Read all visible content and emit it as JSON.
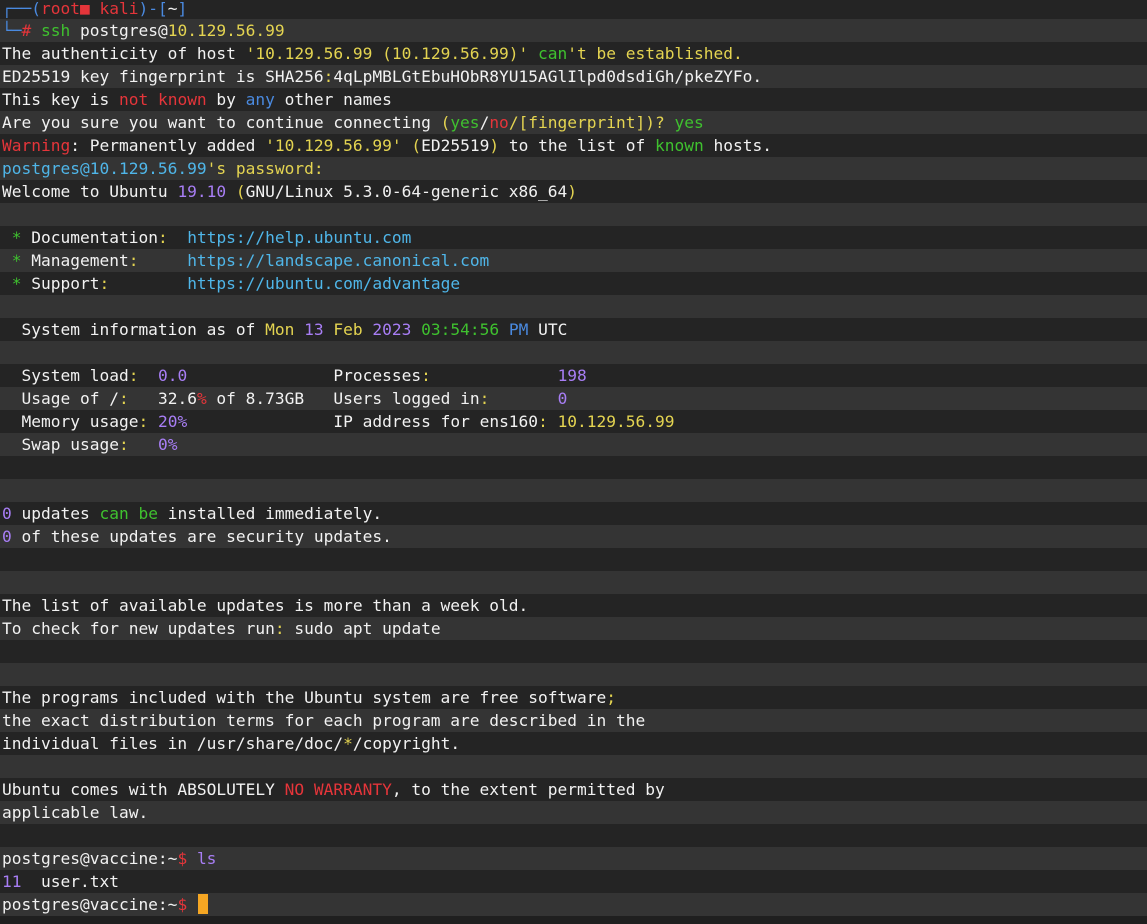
{
  "window": {
    "title": ""
  },
  "colors": {
    "default": "#f2f2f2",
    "blue": "#4a8ae0",
    "red": "#e5353a",
    "green": "#3fc12f",
    "yellow": "#e4d451",
    "purple": "#a87ef5",
    "cyan": "#4fb6e9",
    "cursor": "#f5a623"
  },
  "terminal": {
    "lines": [
      [
        [
          "┌──(",
          "blue"
        ],
        [
          "root",
          "red"
        ],
        [
          "■ ",
          "red"
        ],
        [
          "kali",
          "red"
        ],
        [
          ")-[",
          "blue"
        ],
        [
          "~",
          "default"
        ],
        [
          "]",
          "blue"
        ]
      ],
      [
        [
          "└─",
          "blue"
        ],
        [
          "# ",
          "red"
        ],
        [
          "ssh ",
          "green"
        ],
        [
          "postgres@",
          "default"
        ],
        [
          "10.129.56.99",
          "yellow"
        ]
      ],
      [
        [
          "The authenticity of host ",
          "default"
        ],
        [
          "'10.129.56.99 (10.129.56.99)'",
          "yellow"
        ],
        [
          " ",
          "default"
        ],
        [
          "can",
          "green"
        ],
        [
          "'t be established.",
          "yellow"
        ]
      ],
      [
        [
          "ED25519 key fingerprint is SHA256",
          "default"
        ],
        [
          ":",
          "yellow"
        ],
        [
          "4qLpMBLGtEbuHObR8YU15AGlIlpd0dsdiGh/pkeZYFo.",
          "default"
        ]
      ],
      [
        [
          "This key is ",
          "default"
        ],
        [
          "not",
          "red"
        ],
        [
          " ",
          "default"
        ],
        [
          "known",
          "red"
        ],
        [
          " by ",
          "default"
        ],
        [
          "any",
          "blue"
        ],
        [
          " other names",
          "default"
        ]
      ],
      [
        [
          "Are you sure you want to continue connecting ",
          "default"
        ],
        [
          "(",
          "yellow"
        ],
        [
          "yes",
          "green"
        ],
        [
          "/",
          "default"
        ],
        [
          "no",
          "red"
        ],
        [
          "/[fingerprint])? ",
          "yellow"
        ],
        [
          "yes",
          "green"
        ]
      ],
      [
        [
          "Warning",
          "red"
        ],
        [
          ": Permanently added ",
          "default"
        ],
        [
          "'10.129.56.99'",
          "yellow"
        ],
        [
          " ",
          "default"
        ],
        [
          "(",
          "yellow"
        ],
        [
          "ED25519",
          "default"
        ],
        [
          ")",
          "yellow"
        ],
        [
          " to the list of ",
          "default"
        ],
        [
          "known",
          "green"
        ],
        [
          " hosts.",
          "default"
        ]
      ],
      [
        [
          "postgres@10.129.56.99",
          "cyan"
        ],
        [
          "'s password:",
          "yellow"
        ]
      ],
      [
        [
          "Welcome to Ubuntu ",
          "default"
        ],
        [
          "19.10",
          "purple"
        ],
        [
          " ",
          "default"
        ],
        [
          "(",
          "yellow"
        ],
        [
          "GNU/Linux 5.3.0-64-generic x86_64",
          "default"
        ],
        [
          ")",
          "yellow"
        ]
      ],
      [],
      [
        [
          " ",
          "default"
        ],
        [
          "*",
          "green"
        ],
        [
          " Documentation",
          "default"
        ],
        [
          ":",
          "yellow"
        ],
        [
          "  ",
          "default"
        ],
        [
          "https://help.ubuntu.com",
          "cyan"
        ]
      ],
      [
        [
          " ",
          "default"
        ],
        [
          "*",
          "green"
        ],
        [
          " Management",
          "default"
        ],
        [
          ":",
          "yellow"
        ],
        [
          "     ",
          "default"
        ],
        [
          "https://landscape.canonical.com",
          "cyan"
        ]
      ],
      [
        [
          " ",
          "default"
        ],
        [
          "*",
          "green"
        ],
        [
          " Support",
          "default"
        ],
        [
          ":",
          "yellow"
        ],
        [
          "        ",
          "default"
        ],
        [
          "https://ubuntu.com/advantage",
          "cyan"
        ]
      ],
      [],
      [
        [
          "  System information as of ",
          "default"
        ],
        [
          "Mon",
          "yellow"
        ],
        [
          " ",
          "default"
        ],
        [
          "13",
          "purple"
        ],
        [
          " ",
          "default"
        ],
        [
          "Feb",
          "yellow"
        ],
        [
          " ",
          "default"
        ],
        [
          "2023",
          "purple"
        ],
        [
          " ",
          "default"
        ],
        [
          "03:54:56",
          "green"
        ],
        [
          " ",
          "default"
        ],
        [
          "PM",
          "blue"
        ],
        [
          " UTC",
          "default"
        ]
      ],
      [],
      [
        [
          "  System load",
          "default"
        ],
        [
          ":",
          "yellow"
        ],
        [
          "  ",
          "default"
        ],
        [
          "0.0",
          "purple"
        ],
        [
          "               Processes",
          "default"
        ],
        [
          ":",
          "yellow"
        ],
        [
          "             ",
          "default"
        ],
        [
          "198",
          "purple"
        ]
      ],
      [
        [
          "  Usage of /",
          "default"
        ],
        [
          ":",
          "yellow"
        ],
        [
          "   ",
          "default"
        ],
        [
          "32.6",
          "default"
        ],
        [
          "%",
          "red"
        ],
        [
          " of 8.73GB   Users logged in",
          "default"
        ],
        [
          ":",
          "yellow"
        ],
        [
          "       ",
          "default"
        ],
        [
          "0",
          "purple"
        ]
      ],
      [
        [
          "  Memory usage",
          "default"
        ],
        [
          ":",
          "yellow"
        ],
        [
          " ",
          "default"
        ],
        [
          "20%",
          "purple"
        ],
        [
          "               IP address for ens160",
          "default"
        ],
        [
          ":",
          "yellow"
        ],
        [
          " ",
          "default"
        ],
        [
          "10.129.56.99",
          "yellow"
        ]
      ],
      [
        [
          "  Swap usage",
          "default"
        ],
        [
          ":",
          "yellow"
        ],
        [
          "   ",
          "default"
        ],
        [
          "0%",
          "purple"
        ]
      ],
      [],
      [],
      [
        [
          "0",
          "purple"
        ],
        [
          " updates ",
          "default"
        ],
        [
          "can",
          "green"
        ],
        [
          " ",
          "default"
        ],
        [
          "be",
          "green"
        ],
        [
          " installed immediately.",
          "default"
        ]
      ],
      [
        [
          "0",
          "purple"
        ],
        [
          " of these updates are security updates.",
          "default"
        ]
      ],
      [],
      [],
      [
        [
          "The list of available updates is more than a week old.",
          "default"
        ]
      ],
      [
        [
          "To check for new updates run",
          "default"
        ],
        [
          ":",
          "yellow"
        ],
        [
          " sudo apt update",
          "default"
        ]
      ],
      [],
      [],
      [
        [
          "The programs included with the Ubuntu system are free software",
          "default"
        ],
        [
          ";",
          "yellow"
        ]
      ],
      [
        [
          "the exact distribution terms for each program are described in the",
          "default"
        ]
      ],
      [
        [
          "individual files in /usr/share/doc/",
          "default"
        ],
        [
          "*",
          "yellow"
        ],
        [
          "/copyright.",
          "default"
        ]
      ],
      [],
      [
        [
          "Ubuntu comes with ABSOLUTELY ",
          "default"
        ],
        [
          "NO WARRANTY",
          "red"
        ],
        [
          ", to the extent permitted by",
          "default"
        ]
      ],
      [
        [
          "applicable law.",
          "default"
        ]
      ],
      [],
      [
        [
          "postgres@vaccine:~",
          "default"
        ],
        [
          "$",
          "red"
        ],
        [
          " ",
          "default"
        ],
        [
          "ls",
          "purple"
        ]
      ],
      [
        [
          "11",
          "purple"
        ],
        [
          "  user.txt",
          "default"
        ]
      ],
      [
        [
          "postgres@vaccine:~",
          "default"
        ],
        [
          "$",
          "red"
        ],
        [
          " ",
          "default"
        ]
      ]
    ]
  }
}
